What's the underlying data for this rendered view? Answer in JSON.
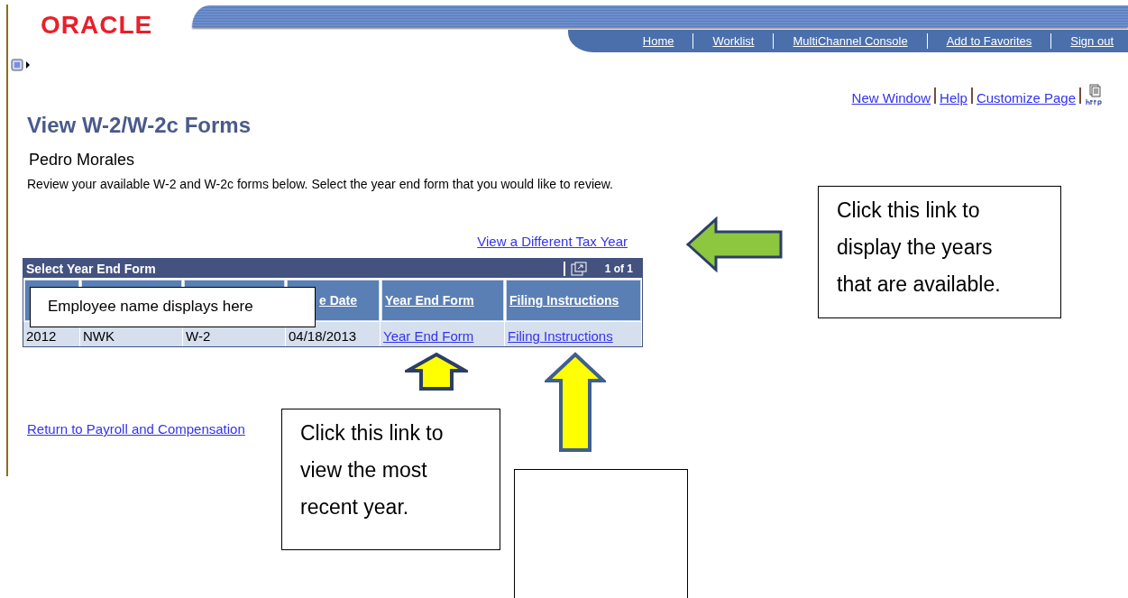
{
  "header": {
    "logo": "ORACLE",
    "nav_links": [
      "Home",
      "Worklist",
      "MultiChannel Console",
      "Add to Favorites",
      "Sign out"
    ]
  },
  "page_links": [
    "New Window",
    "Help",
    "Customize Page"
  ],
  "title": "View W-2/W-2c Forms",
  "employee_name": "Pedro Morales",
  "instructions": "Review your available W-2 and W-2c forms below. Select the year end form that you would like to review.",
  "tax_year_link": "View a Different Tax Year",
  "grid": {
    "title": "Select Year End Form",
    "pager": "1 of 1",
    "visible_headers": [
      "e Date",
      "Year End Form",
      "Filing Instructions"
    ],
    "rows": [
      {
        "cells": [
          "2012",
          "NWK",
          "W-2",
          "04/18/2013"
        ],
        "links": [
          "Year End Form",
          "Filing Instructions"
        ]
      }
    ]
  },
  "return_link": "Return to Payroll and Compensation",
  "callouts": [
    {
      "kind": "note",
      "text": "Click this link to display the years that are available."
    },
    {
      "kind": "label",
      "text": "Employee name displays here"
    },
    {
      "kind": "note",
      "text": "Click this link to view the most recent year."
    },
    {
      "kind": "blank"
    }
  ]
}
